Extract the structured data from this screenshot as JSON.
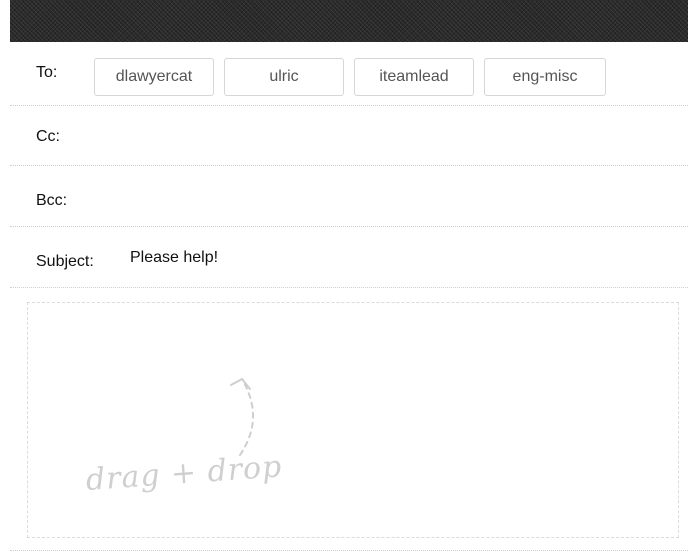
{
  "compose": {
    "to": {
      "label": "To:",
      "recipients": [
        "dlawyercat",
        "ulric",
        "iteamlead",
        "eng-misc"
      ]
    },
    "cc": {
      "label": "Cc:"
    },
    "bcc": {
      "label": "Bcc:"
    },
    "subject": {
      "label": "Subject:",
      "value": "Please help!"
    },
    "drop_zone": {
      "text": "drag + drop",
      "icon": "curved-arrow-up-icon"
    }
  },
  "colors": {
    "top_bar": "#2b2b2b",
    "chip_border": "#d6d6d6",
    "chip_text": "#555555",
    "drop_hint": "#cfcfcf"
  }
}
